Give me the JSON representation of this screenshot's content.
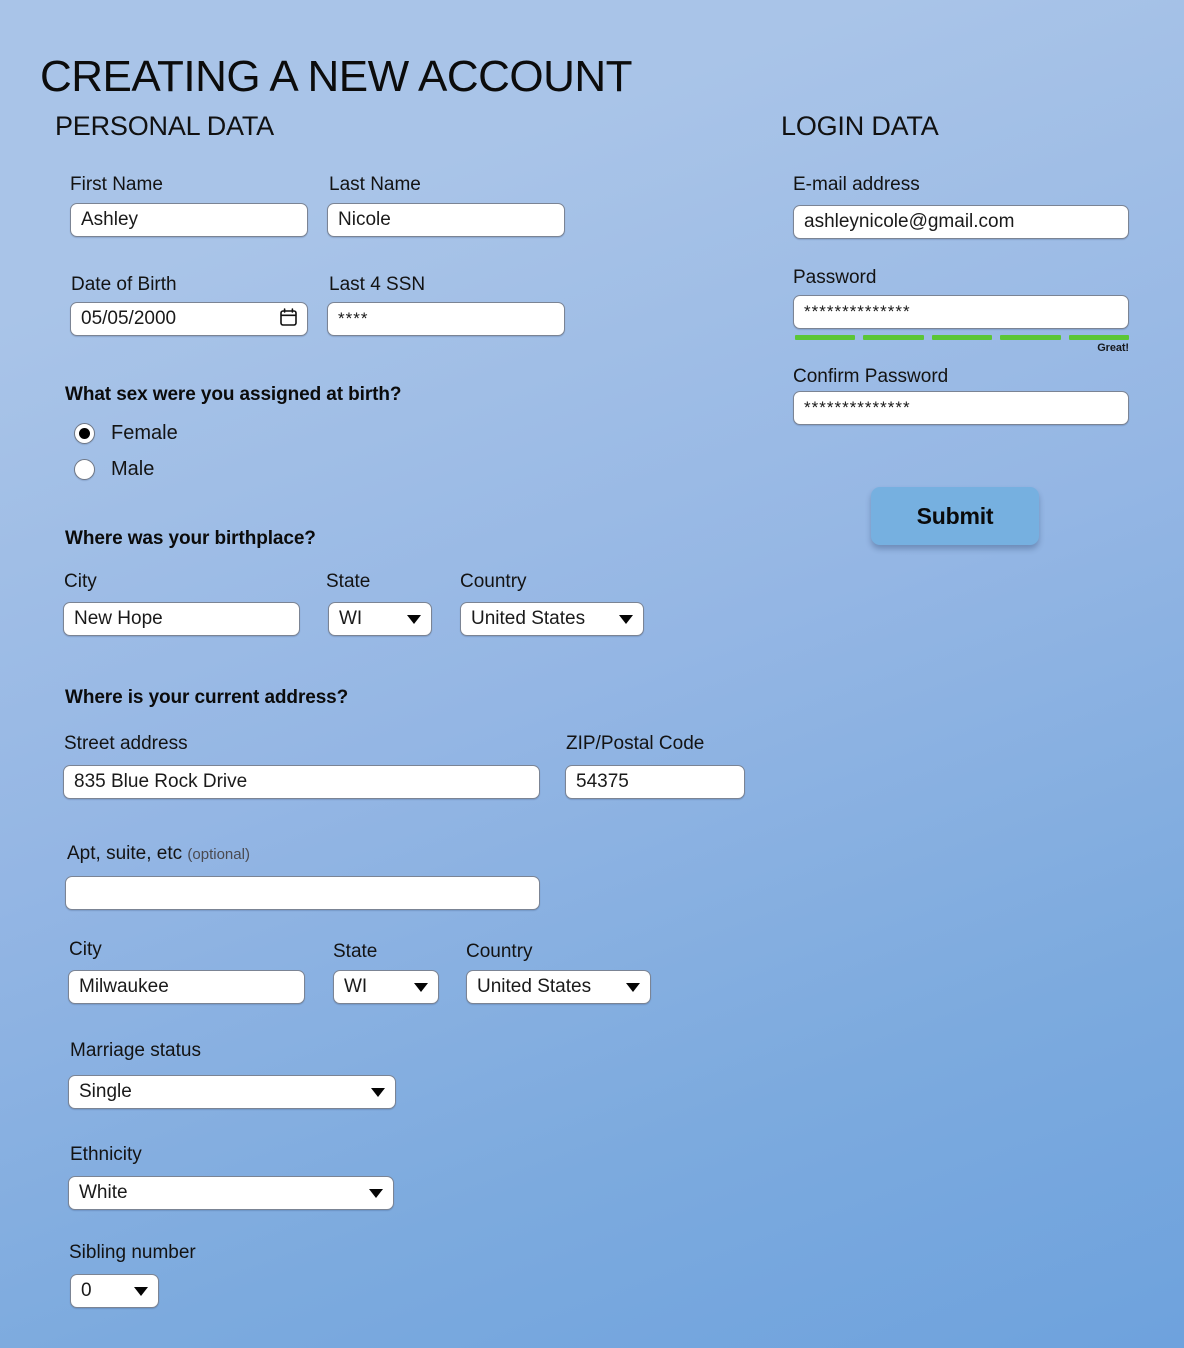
{
  "page": {
    "title": "CREATING A NEW ACCOUNT",
    "background_top_color": "#a9c4e8",
    "background_bottom_color": "#6ea2dd"
  },
  "personal": {
    "section_title": "PERSONAL DATA",
    "first_name": {
      "label": "First Name",
      "value": "Ashley"
    },
    "last_name": {
      "label": "Last Name",
      "value": "Nicole"
    },
    "date_of_birth": {
      "label": "Date of Birth",
      "value": "05/05/2000",
      "icon": "calendar-icon"
    },
    "last4_ssn": {
      "label": "Last 4 SSN",
      "value": "****"
    },
    "sex_question": {
      "heading": "What sex were you assigned at birth?",
      "options": [
        {
          "label": "Female",
          "selected": true
        },
        {
          "label": "Male",
          "selected": false
        }
      ]
    },
    "birthplace": {
      "heading": "Where was your birthplace?",
      "city": {
        "label": "City",
        "value": "New Hope"
      },
      "state": {
        "label": "State",
        "value": "WI"
      },
      "country": {
        "label": "Country",
        "value": "United States"
      }
    },
    "current_address": {
      "heading": "Where is your current address?",
      "street": {
        "label": "Street address",
        "value": "835 Blue Rock Drive"
      },
      "zip": {
        "label": "ZIP/Postal Code",
        "value": "54375"
      },
      "apt": {
        "label": "Apt, suite, etc",
        "optional_note": "(optional)",
        "value": ""
      },
      "city": {
        "label": "City",
        "value": "Milwaukee"
      },
      "state": {
        "label": "State",
        "value": "WI"
      },
      "country": {
        "label": "Country",
        "value": "United States"
      }
    },
    "marriage_status": {
      "label": "Marriage status",
      "value": "Single"
    },
    "ethnicity": {
      "label": "Ethnicity",
      "value": "White"
    },
    "sibling_number": {
      "label": "Sibling number",
      "value": "0"
    }
  },
  "login": {
    "section_title": "LOGIN DATA",
    "email": {
      "label": "E-mail address",
      "value": "ashleynicole@gmail.com"
    },
    "password": {
      "label": "Password",
      "value": "**************"
    },
    "strength_meter": {
      "segments_total": 5,
      "segments_filled": 5,
      "status_text": "Great!",
      "fill_color": "#5bc636"
    },
    "confirm_password": {
      "label": "Confirm Password",
      "value": "**************"
    },
    "submit": {
      "label": "Submit",
      "color": "#76b0e0"
    }
  }
}
